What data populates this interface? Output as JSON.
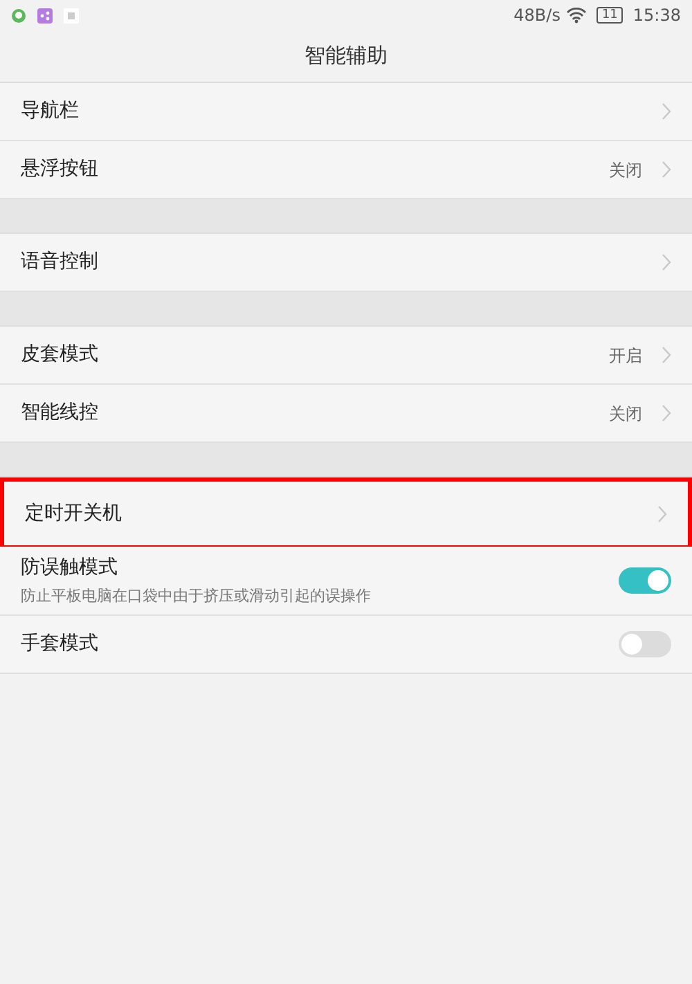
{
  "status_bar": {
    "speed": "48B/s",
    "battery": "11",
    "time": "15:38"
  },
  "title": "智能辅助",
  "groups": [
    {
      "items": [
        {
          "kind": "link",
          "label": "导航栏",
          "highlighted": false
        },
        {
          "kind": "link",
          "label": "悬浮按钮",
          "value": "关闭",
          "highlighted": false
        }
      ]
    },
    {
      "items": [
        {
          "kind": "link",
          "label": "语音控制",
          "highlighted": false
        }
      ]
    },
    {
      "items": [
        {
          "kind": "link",
          "label": "皮套模式",
          "value": "开启",
          "highlighted": false
        },
        {
          "kind": "link",
          "label": "智能线控",
          "value": "关闭",
          "highlighted": false
        }
      ]
    },
    {
      "items": [
        {
          "kind": "link",
          "label": "定时开关机",
          "highlighted": true
        },
        {
          "kind": "toggle",
          "label": "防误触模式",
          "description": "防止平板电脑在口袋中由于挤压或滑动引起的误操作",
          "on": true
        },
        {
          "kind": "toggle",
          "label": "手套模式",
          "on": false
        }
      ]
    }
  ]
}
